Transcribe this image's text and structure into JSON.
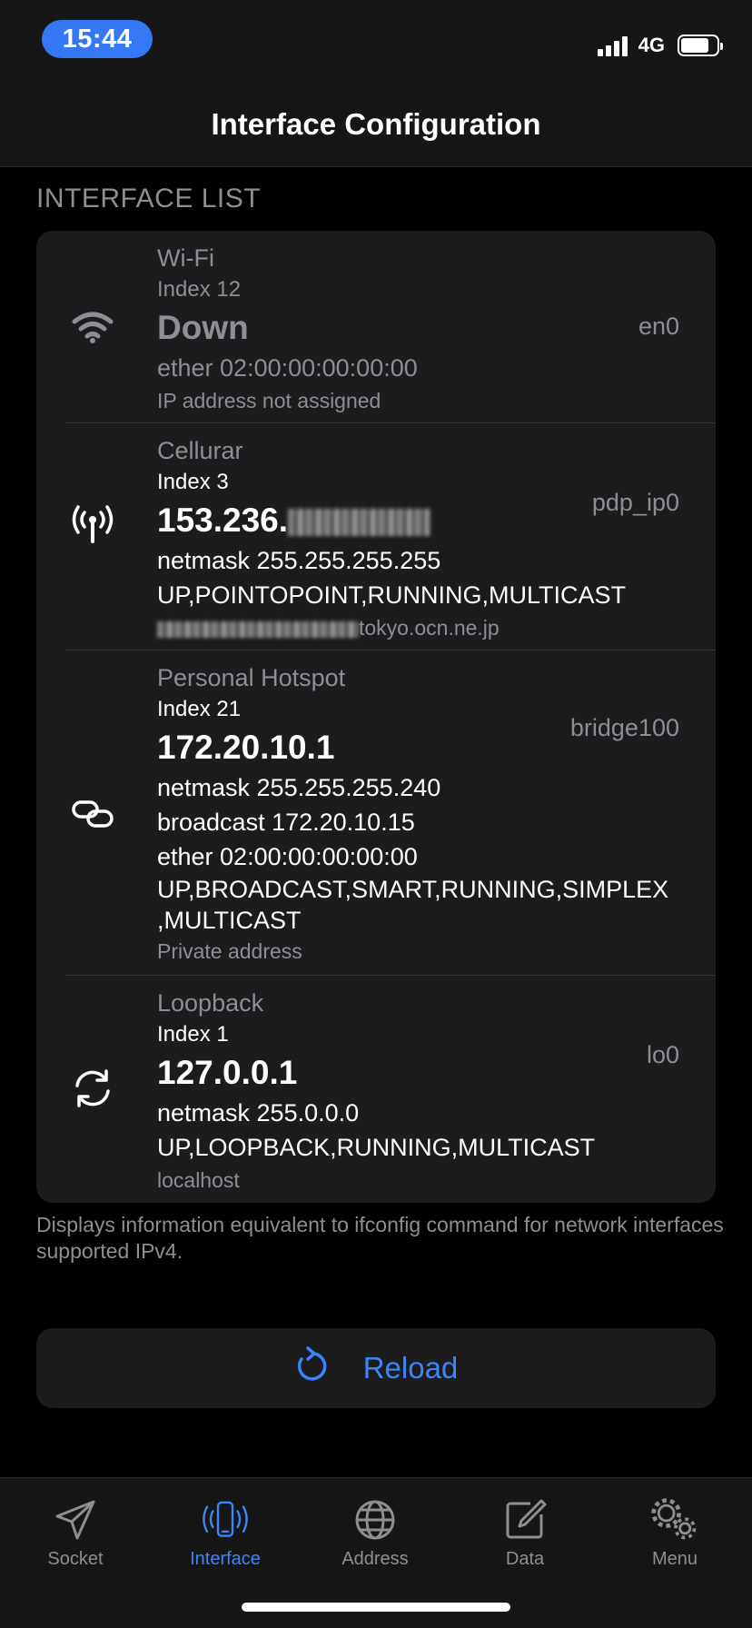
{
  "status_bar": {
    "time": "15:44",
    "network": "4G",
    "battery_level": 0.8
  },
  "nav": {
    "title": "Interface Configuration"
  },
  "section": {
    "title": "INTERFACE LIST"
  },
  "interfaces": [
    {
      "name": "Wi-Fi",
      "index": "Index 12",
      "address": "Down",
      "interface": "en0",
      "lines": [
        "ether 02:00:00:00:00:00"
      ],
      "note": "IP address not assigned",
      "icon": "wifi-icon"
    },
    {
      "name": "Cellurar",
      "index": "Index 3",
      "address": "153.236.",
      "interface": "pdp_ip0",
      "lines": [
        "netmask 255.255.255.255",
        "UP,POINTOPOINT,RUNNING,MULTICAST"
      ],
      "note": "tokyo.ocn.ne.jp",
      "icon": "antenna-icon"
    },
    {
      "name": "Personal Hotspot",
      "index": "Index 21",
      "address": "172.20.10.1",
      "interface": "bridge100",
      "lines": [
        "netmask 255.255.255.240",
        "broadcast 172.20.10.15",
        "ether 02:00:00:00:00:00",
        "UP,BROADCAST,SMART,RUNNING,SIMPLEX",
        ",MULTICAST"
      ],
      "note": "Private address",
      "icon": "link-icon"
    },
    {
      "name": "Loopback",
      "index": "Index 1",
      "address": "127.0.0.1",
      "interface": "lo0",
      "lines": [
        "netmask 255.0.0.0",
        "UP,LOOPBACK,RUNNING,MULTICAST"
      ],
      "note": "localhost",
      "icon": "loop-icon"
    }
  ],
  "footnote": "Displays information equivalent to ifconfig command for network interfaces supported IPv4.",
  "reload": {
    "label": "Reload",
    "icon": "refresh-icon"
  },
  "tabs": [
    {
      "label": "Socket",
      "icon": "paperplane-icon",
      "active": false
    },
    {
      "label": "Interface",
      "icon": "phone-wave-icon",
      "active": true
    },
    {
      "label": "Address",
      "icon": "globe-icon",
      "active": false
    },
    {
      "label": "Data",
      "icon": "compose-icon",
      "active": false
    },
    {
      "label": "Menu",
      "icon": "gears-icon",
      "active": false
    }
  ],
  "colors": {
    "accent": "#3b86f7",
    "time_pill": "#3478f6",
    "card": "#1c1c1e",
    "secondary_text": "#8e8e93"
  }
}
